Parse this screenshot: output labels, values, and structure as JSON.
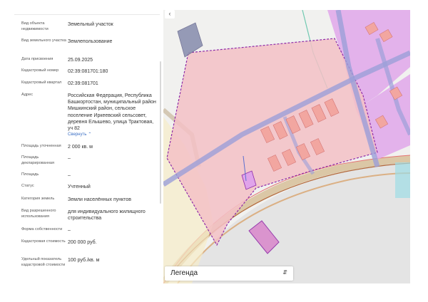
{
  "property": {
    "rows": [
      {
        "label": "Вид объекта недвижимости",
        "value": "Земельный участок"
      },
      {
        "label": "Вид земельного участка",
        "value": "Землепользование"
      },
      {
        "label": "Дата присвоения",
        "value": "25.09.2025"
      },
      {
        "label": "Кадастровый номер",
        "value": "02:39:081701:180"
      },
      {
        "label": "Кадастровый квартал",
        "value": "02:39:081701"
      },
      {
        "label": "Адрес",
        "value": "Российская Федерация, Республика Башкортостан, муниципальный район Мишкинский район, сельское поселение Иркеевский сельсовет, деревня Елышево, улица Трактовая, уч 82"
      },
      {
        "label": "Площадь уточненная",
        "value": "2 000 кв. м"
      },
      {
        "label": "Площадь декларированная",
        "value": "–"
      },
      {
        "label": "Площадь",
        "value": "–"
      },
      {
        "label": "Статус",
        "value": "Учтенный"
      },
      {
        "label": "Категория земель",
        "value": "Земли населённых пунктов"
      },
      {
        "label": "Вид разрешенного использования",
        "value": "для индивидуального жилищного строительства"
      },
      {
        "label": "Форма собственности",
        "value": "–"
      },
      {
        "label": "Кадастровая стоимость",
        "value": "200 000 руб."
      },
      {
        "label": "Удельный показатель кадастровой стоимости",
        "value": "100 руб./кв. м"
      }
    ],
    "collapse_label": "Свернуть"
  },
  "map": {
    "collapse_icon": "chevron-left-icon",
    "legend_label": "Легенда",
    "legend_icon": "sort-updown-icon",
    "colors": {
      "parcel_fill": "#f3c1c6",
      "parcel_border": "#8e2ba8",
      "zone_fill": "#e0a3ea",
      "building": "#f2a6a0",
      "road": "#9b9fd8",
      "river_bank": "#c9a46a",
      "water": "#9edde5"
    }
  }
}
